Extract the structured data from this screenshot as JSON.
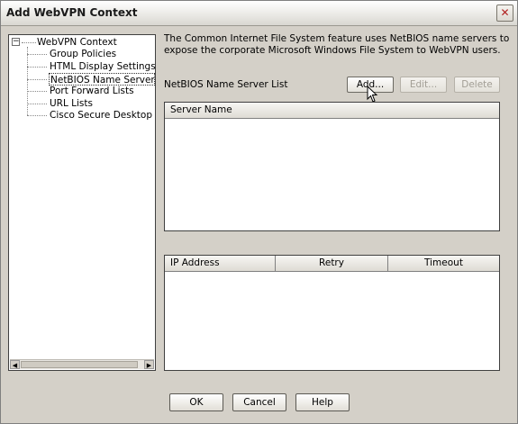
{
  "window": {
    "title": "Add WebVPN Context",
    "close_glyph": "✕"
  },
  "tree": {
    "root_label": "WebVPN Context",
    "expander_glyph": "−",
    "items": [
      {
        "label": "Group Policies",
        "selected": false
      },
      {
        "label": "HTML Display Settings",
        "selected": false
      },
      {
        "label": "NetBIOS Name Server Lis",
        "selected": true
      },
      {
        "label": "Port Forward Lists",
        "selected": false
      },
      {
        "label": "URL Lists",
        "selected": false
      },
      {
        "label": "Cisco Secure Desktop",
        "selected": false
      }
    ],
    "scroll_left_glyph": "◀",
    "scroll_right_glyph": "▶"
  },
  "description": "The Common Internet File System feature uses NetBIOS name servers to expose the corporate Microsoft Windows File System to WebVPN users.",
  "netbios": {
    "label": "NetBIOS Name Server List",
    "add_label": "Add...",
    "edit_label": "Edit...",
    "delete_label": "Delete"
  },
  "server_list": {
    "columns": [
      "Server Name"
    ],
    "rows": []
  },
  "ip_list": {
    "columns": [
      "IP Address",
      "Retry",
      "Timeout"
    ],
    "rows": []
  },
  "dialog": {
    "ok_label": "OK",
    "cancel_label": "Cancel",
    "help_label": "Help"
  }
}
